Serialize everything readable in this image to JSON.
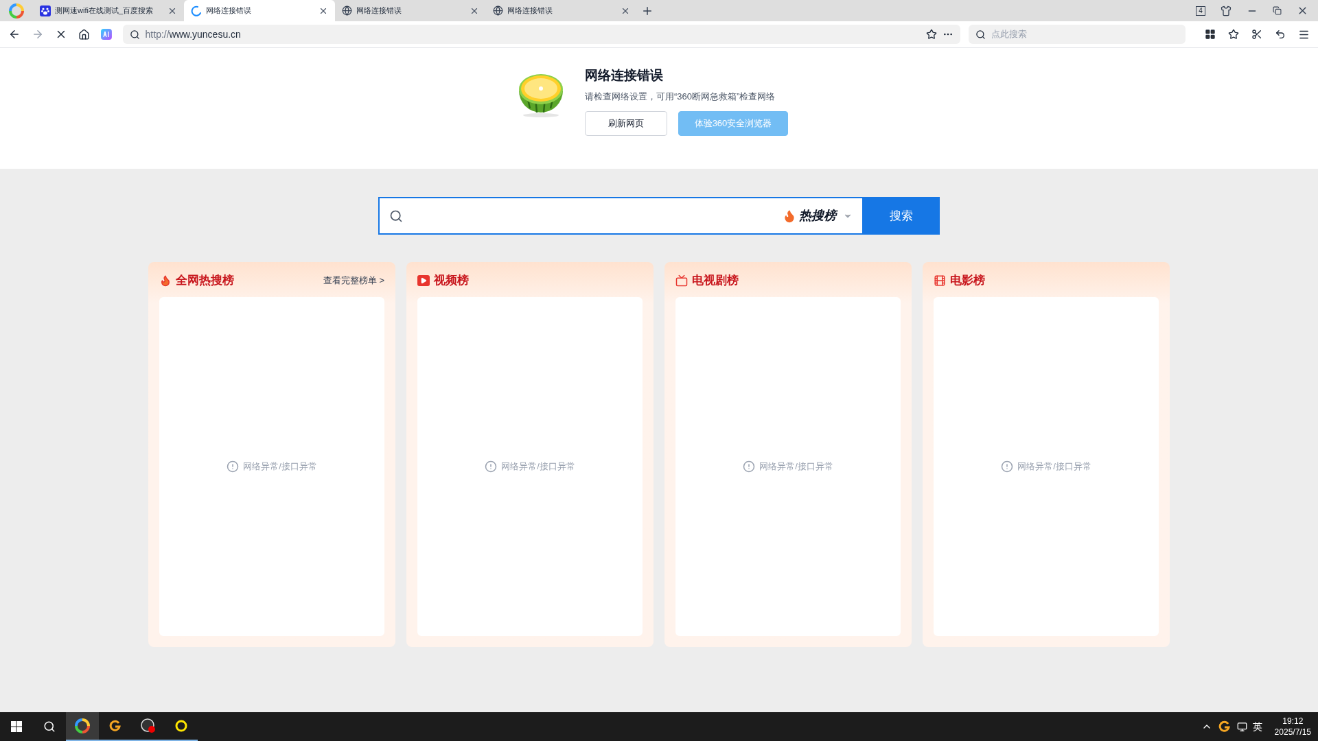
{
  "tabs": [
    {
      "kind": "baidu",
      "title": "测网速wifi在线测试_百度搜索",
      "selected": false
    },
    {
      "kind": "loading",
      "title": "网络连接错误",
      "selected": true
    },
    {
      "kind": "globe",
      "title": "网络连接错误",
      "selected": false
    },
    {
      "kind": "globe",
      "title": "网络连接错误",
      "selected": false
    }
  ],
  "tab_count": "4",
  "address": {
    "scheme": "http://",
    "host": "www.yuncesu.cn"
  },
  "toolbar_search": {
    "placeholder": "点此搜索"
  },
  "error": {
    "title": "网络连接错误",
    "message": "请检查网络设置，可用“360断网急救箱”检查网络",
    "buttons": [
      {
        "kind": "plain",
        "label": "刷新网页"
      },
      {
        "kind": "primary",
        "label": "体验360安全浏览器"
      }
    ]
  },
  "search": {
    "hot_label": "热搜榜",
    "button": "搜索"
  },
  "cards": [
    {
      "kind": "fire",
      "title": "全网热搜榜",
      "link": "查看完整榜单 >",
      "status": "网络异常/接口异常"
    },
    {
      "kind": "video",
      "title": "视频榜",
      "status": "网络异常/接口异常"
    },
    {
      "kind": "tv",
      "title": "电视剧榜",
      "status": "网络异常/接口异常"
    },
    {
      "kind": "film",
      "title": "电影榜",
      "status": "网络异常/接口异常"
    }
  ],
  "taskbar": {
    "apps": [
      {
        "kind": "browser360",
        "selected": true
      },
      {
        "kind": "g",
        "selected": false
      },
      {
        "kind": "obs",
        "selected": false
      },
      {
        "kind": "ring",
        "selected": false
      }
    ],
    "ime": "英",
    "time": "19:12",
    "date": "2025/7/15"
  }
}
